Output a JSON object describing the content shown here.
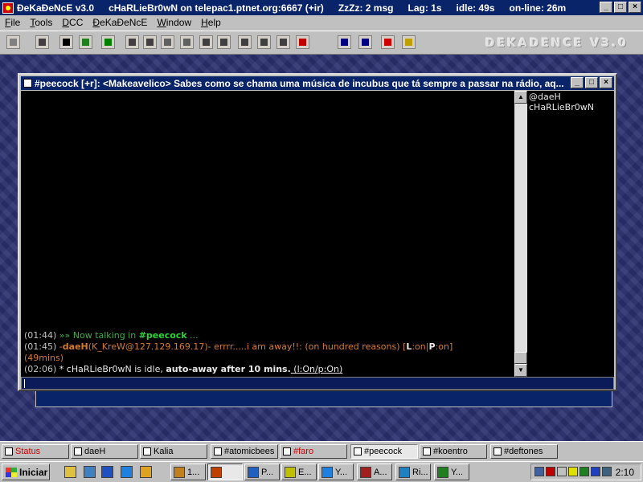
{
  "titlebar": {
    "app_name": "ÐeKaÐeNcE v3.0",
    "connection": "cHaRLieBr0wN on telepac1.ptnet.org:6667 (+ir)",
    "zzz": "ZzZz: 2 msg",
    "lag": "Lag: 1s",
    "idle": "idle: 49s",
    "online": "on-line: 26m",
    "buttons": [
      "_",
      "□",
      "×"
    ]
  },
  "menu": [
    "File",
    "Tools",
    "DCC",
    "ÐeKaÐeNcE",
    "Window",
    "Help"
  ],
  "toolbar": {
    "brand": "DEKADENCE V3.0",
    "buttons": [
      {
        "name": "connect-icon",
        "color": "#808080"
      },
      {
        "name": "options-icon",
        "color": "#404040"
      },
      {
        "name": "address-book-icon",
        "color": "#000000"
      },
      {
        "name": "globe-icon",
        "color": "#208020"
      },
      {
        "name": "script-editor-icon",
        "color": "#008000"
      },
      {
        "name": "chat-window-icon",
        "color": "#404040"
      },
      {
        "name": "aliases-icon",
        "color": "#404040"
      },
      {
        "name": "hand-icon",
        "color": "#606060"
      },
      {
        "name": "clock-icon",
        "color": "#606060"
      },
      {
        "name": "grid-icon",
        "color": "#404040"
      },
      {
        "name": "grid2-icon",
        "color": "#404040"
      },
      {
        "name": "notes-icon",
        "color": "#404040"
      },
      {
        "name": "notes2-icon",
        "color": "#404040"
      },
      {
        "name": "notes3-icon",
        "color": "#404040"
      },
      {
        "name": "red-grid-icon",
        "color": "#c00000"
      },
      {
        "name": "window-tile-icon",
        "color": "#000080"
      },
      {
        "name": "window-cascade-icon",
        "color": "#000080"
      },
      {
        "name": "lifebuoy-icon",
        "color": "#d00000"
      },
      {
        "name": "person-icon",
        "color": "#c0a000"
      }
    ]
  },
  "channel": {
    "title": "#peecock [+r]: <Makeavelico> Sabes como se chama uma música de incubus que tá sempre a passar na rádio, aq...",
    "buttons": [
      "_",
      "□",
      "×"
    ],
    "lines": [
      [
        {
          "t": "(01:44) ",
          "c": "c-gray"
        },
        {
          "t": "»» Now talking in ",
          "c": "c-green"
        },
        {
          "t": "#peecock",
          "c": "c-lgreen"
        },
        {
          "t": " ...",
          "c": "c-green"
        }
      ],
      [
        {
          "t": "(01:45) ",
          "c": "c-gray"
        },
        {
          "t": "-",
          "c": "c-orange"
        },
        {
          "t": "daeH",
          "c": "c-orange",
          "b": true
        },
        {
          "t": "(K_KreW@127.129.169.17)- errrr.....i am away!!: (on hundred reasons) [",
          "c": "c-orange"
        },
        {
          "t": "L",
          "c": "c-white",
          "b": true
        },
        {
          "t": ":on|",
          "c": "c-orange"
        },
        {
          "t": "P",
          "c": "c-white",
          "b": true
        },
        {
          "t": ":on]",
          "c": "c-orange"
        }
      ],
      [
        {
          "t": "(49mins)",
          "c": "c-orange"
        }
      ],
      [
        {
          "t": "(02:06) ",
          "c": "c-gray"
        },
        {
          "t": "* cHaRLieBr0wN is idle, ",
          "c": "c-white"
        },
        {
          "t": "auto-away after 10 mins.",
          "c": "c-white",
          "b": true
        },
        {
          "t": " (l:On/p:On)",
          "c": "c-white",
          "u": true
        }
      ]
    ],
    "nicks": [
      "@daeH",
      "cHaRLieBr0wN"
    ]
  },
  "switchbar": [
    {
      "label": "Status",
      "color": "#d00000",
      "active": false
    },
    {
      "label": "daeH",
      "color": "#000000",
      "active": false
    },
    {
      "label": "Kalia",
      "color": "#000000",
      "active": false
    },
    {
      "label": "#atomicbees",
      "color": "#000000",
      "active": false
    },
    {
      "label": "#faro",
      "color": "#d00000",
      "active": false
    },
    {
      "label": "#peecock",
      "color": "#000000",
      "active": true
    },
    {
      "label": "#koentro",
      "color": "#000000",
      "active": false
    },
    {
      "label": "#deftones",
      "color": "#000000",
      "active": false
    }
  ],
  "taskbar": {
    "start": "Iniciar",
    "quicklaunch": [
      {
        "name": "notepad-icon",
        "color": "#e0c040"
      },
      {
        "name": "desktop-icon",
        "color": "#4080c0"
      },
      {
        "name": "outlook-icon",
        "color": "#2050c0"
      },
      {
        "name": "ie-icon",
        "color": "#2080e0"
      },
      {
        "name": "pencil-icon",
        "color": "#e0a020"
      }
    ],
    "tasks": [
      {
        "label": "1...",
        "icon": "#c08020",
        "active": false
      },
      {
        "label": "",
        "icon": "#c04000",
        "active": true
      },
      {
        "label": "P...",
        "icon": "#2060c0",
        "active": false
      },
      {
        "label": "E...",
        "icon": "#c0c000",
        "active": false
      },
      {
        "label": "Y...",
        "icon": "#2080e0",
        "active": false
      },
      {
        "label": "A...",
        "icon": "#a02020",
        "active": false
      },
      {
        "label": "Ri...",
        "icon": "#2080c0",
        "active": false
      },
      {
        "label": "Y...",
        "icon": "#208020",
        "active": false
      }
    ],
    "tray": [
      {
        "name": "network-icon",
        "color": "#4060a0"
      },
      {
        "name": "block-icon",
        "color": "#c00000"
      },
      {
        "name": "scheduler-icon",
        "color": "#c0c0c0"
      },
      {
        "name": "battery-icon",
        "color": "#e0e000"
      },
      {
        "name": "messenger-icon",
        "color": "#208020"
      },
      {
        "name": "chat-icon",
        "color": "#2040c0"
      },
      {
        "name": "monitor-icon",
        "color": "#406080"
      }
    ],
    "clock": "2:10"
  }
}
